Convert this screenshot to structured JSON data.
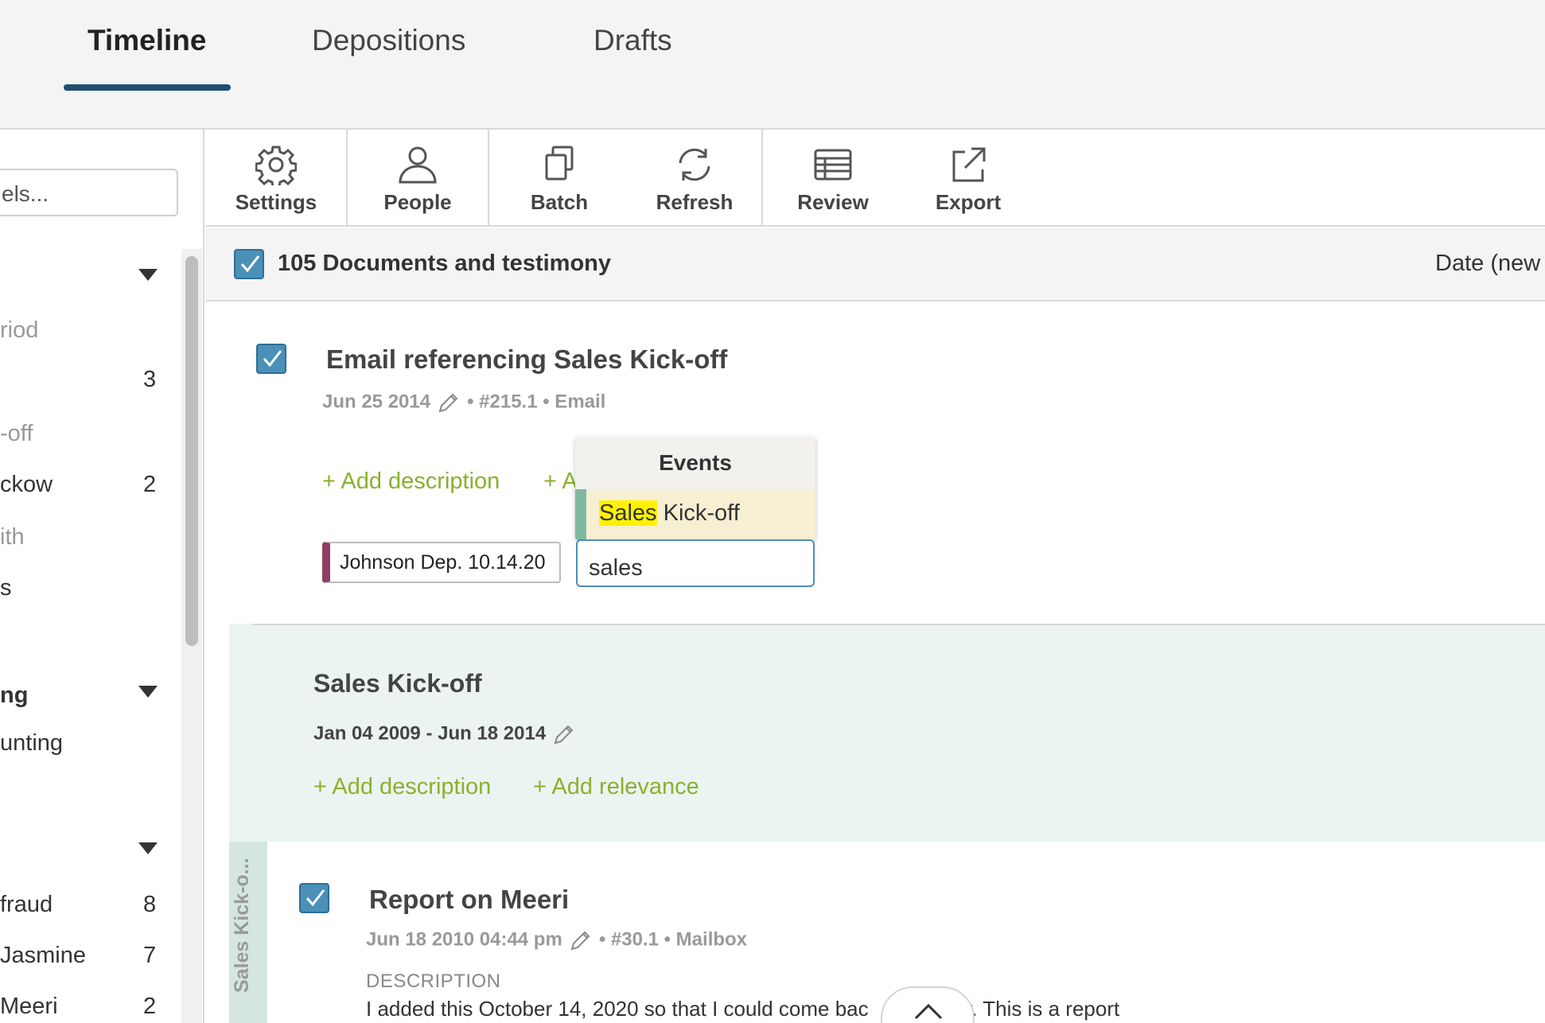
{
  "tabs": [
    {
      "label": "Timeline",
      "active": true
    },
    {
      "label": "Depositions",
      "active": false
    },
    {
      "label": "Drafts",
      "active": false
    }
  ],
  "sidebar": {
    "search_value": "els...",
    "items": [
      {
        "label": "riod",
        "muted": true,
        "count": ""
      },
      {
        "label": "",
        "muted": false,
        "count": "3"
      },
      {
        "label": "-off",
        "muted": true,
        "count": ""
      },
      {
        "label": "ckow",
        "muted": false,
        "count": "2"
      },
      {
        "label": "ith",
        "muted": true,
        "count": ""
      },
      {
        "label": "s",
        "muted": false,
        "count": ""
      },
      {
        "label": "ng",
        "muted": false,
        "count": ""
      },
      {
        "label": "unting",
        "muted": false,
        "count": ""
      },
      {
        "label": " fraud",
        "muted": false,
        "count": "8"
      },
      {
        "label": " Jasmine",
        "muted": false,
        "count": "7"
      },
      {
        "label": " Meeri",
        "muted": false,
        "count": "2"
      }
    ]
  },
  "toolbar": {
    "settings": "Settings",
    "people": "People",
    "batch": "Batch",
    "refresh": "Refresh",
    "review": "Review",
    "export": "Export"
  },
  "list_header": {
    "title": "105 Documents and testimony",
    "sort": "Date (new"
  },
  "entry1": {
    "title": "Email referencing Sales Kick-off",
    "date": "Jun 25 2014",
    "meta": "• #215.1 • Email",
    "add_description": "+ Add description",
    "add_other": "+ A",
    "tag": "Johnson Dep. 10.14.20"
  },
  "dropdown": {
    "header": "Events",
    "item_match": "Sales",
    "item_rest": " Kick-off",
    "input_value": "sales"
  },
  "event": {
    "title": "Sales Kick-off",
    "date_range": "Jan 04 2009 - Jun 18 2014",
    "add_description": "+ Add description",
    "add_relevance": "+ Add relevance",
    "side_label": "Sales Kick-o..."
  },
  "entry2": {
    "title": "Report on Meeri",
    "date": "Jun 18 2010 04:44 pm",
    "meta": "• #30.1 • Mailbox",
    "description_label": "DESCRIPTION",
    "description_text_a": "I added this October 14, 2020 so that I could come bac",
    "description_text_b": "er. This is a report"
  },
  "colors": {
    "tab_underline": "#1f4e73",
    "checkbox": "#4a90b8",
    "add_link": "#8ab12c",
    "event_bg": "#ebf4f1",
    "tag_stripe": "#8c3e63",
    "dropdown_stripe": "#7fb9a1",
    "highlight": "#fff200"
  }
}
